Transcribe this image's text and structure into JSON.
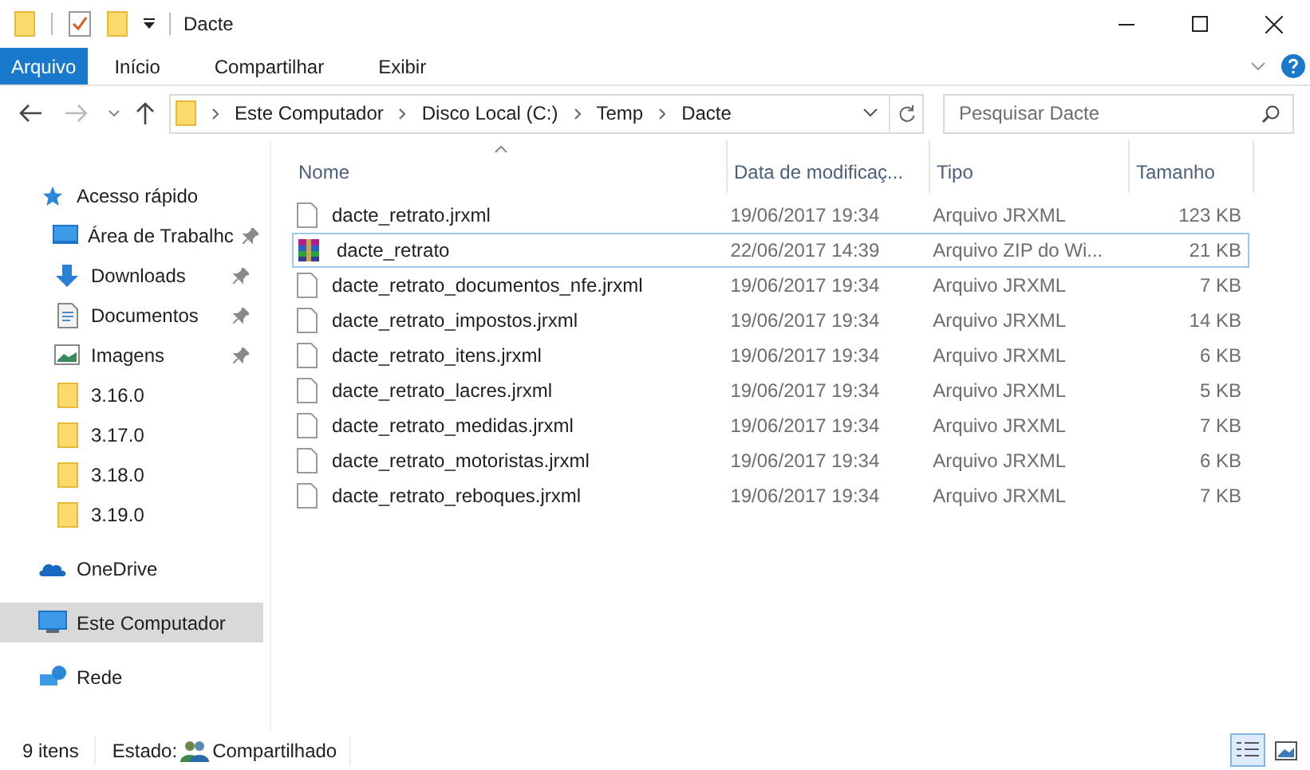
{
  "window": {
    "title": "Dacte"
  },
  "ribbon_tabs": [
    {
      "label": "Arquivo",
      "selected": true
    },
    {
      "label": "Início",
      "selected": false
    },
    {
      "label": "Compartilhar",
      "selected": false
    },
    {
      "label": "Exibir",
      "selected": false
    }
  ],
  "address_bar": {
    "path": [
      "Este Computador",
      "Disco Local (C:)",
      "Temp",
      "Dacte"
    ]
  },
  "search": {
    "placeholder": "Pesquisar Dacte"
  },
  "sidebar": {
    "items": [
      {
        "kind": "quick",
        "label": "Acesso rápido",
        "pinned": false,
        "selected": false
      },
      {
        "kind": "desktop",
        "label": "Área de Trabalhc",
        "pinned": true,
        "selected": false
      },
      {
        "kind": "downloads",
        "label": "Downloads",
        "pinned": true,
        "selected": false
      },
      {
        "kind": "documents",
        "label": "Documentos",
        "pinned": true,
        "selected": false
      },
      {
        "kind": "pictures",
        "label": "Imagens",
        "pinned": true,
        "selected": false
      },
      {
        "kind": "folder",
        "label": "3.16.0",
        "pinned": false,
        "selected": false
      },
      {
        "kind": "folder",
        "label": "3.17.0",
        "pinned": false,
        "selected": false
      },
      {
        "kind": "folder",
        "label": "3.18.0",
        "pinned": false,
        "selected": false
      },
      {
        "kind": "folder",
        "label": "3.19.0",
        "pinned": false,
        "selected": false
      },
      {
        "kind": "onedrive",
        "label": "OneDrive",
        "pinned": false,
        "selected": false
      },
      {
        "kind": "computer",
        "label": "Este Computador",
        "pinned": false,
        "selected": true
      },
      {
        "kind": "network",
        "label": "Rede",
        "pinned": false,
        "selected": false
      }
    ]
  },
  "table": {
    "columns": [
      "Nome",
      "Data de modificaç...",
      "Tipo",
      "Tamanho"
    ],
    "rows": [
      {
        "kind": "file",
        "name": "dacte_retrato.jrxml",
        "date": "19/06/2017 19:34",
        "type": "Arquivo JRXML",
        "size": "123 KB",
        "selected": false
      },
      {
        "kind": "archive",
        "name": "dacte_retrato",
        "date": "22/06/2017 14:39",
        "type": "Arquivo ZIP do Wi...",
        "size": "21 KB",
        "selected": true
      },
      {
        "kind": "file",
        "name": "dacte_retrato_documentos_nfe.jrxml",
        "date": "19/06/2017 19:34",
        "type": "Arquivo JRXML",
        "size": "7 KB",
        "selected": false
      },
      {
        "kind": "file",
        "name": "dacte_retrato_impostos.jrxml",
        "date": "19/06/2017 19:34",
        "type": "Arquivo JRXML",
        "size": "14 KB",
        "selected": false
      },
      {
        "kind": "file",
        "name": "dacte_retrato_itens.jrxml",
        "date": "19/06/2017 19:34",
        "type": "Arquivo JRXML",
        "size": "6 KB",
        "selected": false
      },
      {
        "kind": "file",
        "name": "dacte_retrato_lacres.jrxml",
        "date": "19/06/2017 19:34",
        "type": "Arquivo JRXML",
        "size": "5 KB",
        "selected": false
      },
      {
        "kind": "file",
        "name": "dacte_retrato_medidas.jrxml",
        "date": "19/06/2017 19:34",
        "type": "Arquivo JRXML",
        "size": "7 KB",
        "selected": false
      },
      {
        "kind": "file",
        "name": "dacte_retrato_motoristas.jrxml",
        "date": "19/06/2017 19:34",
        "type": "Arquivo JRXML",
        "size": "6 KB",
        "selected": false
      },
      {
        "kind": "file",
        "name": "dacte_retrato_reboques.jrxml",
        "date": "19/06/2017 19:34",
        "type": "Arquivo JRXML",
        "size": "7 KB",
        "selected": false
      }
    ]
  },
  "status_bar": {
    "count": "9 itens",
    "state_label": "Estado:",
    "state": "Compartilhado",
    "views": [
      {
        "kind": "details",
        "selected": true
      },
      {
        "kind": "thumbnails",
        "selected": false
      }
    ]
  }
}
